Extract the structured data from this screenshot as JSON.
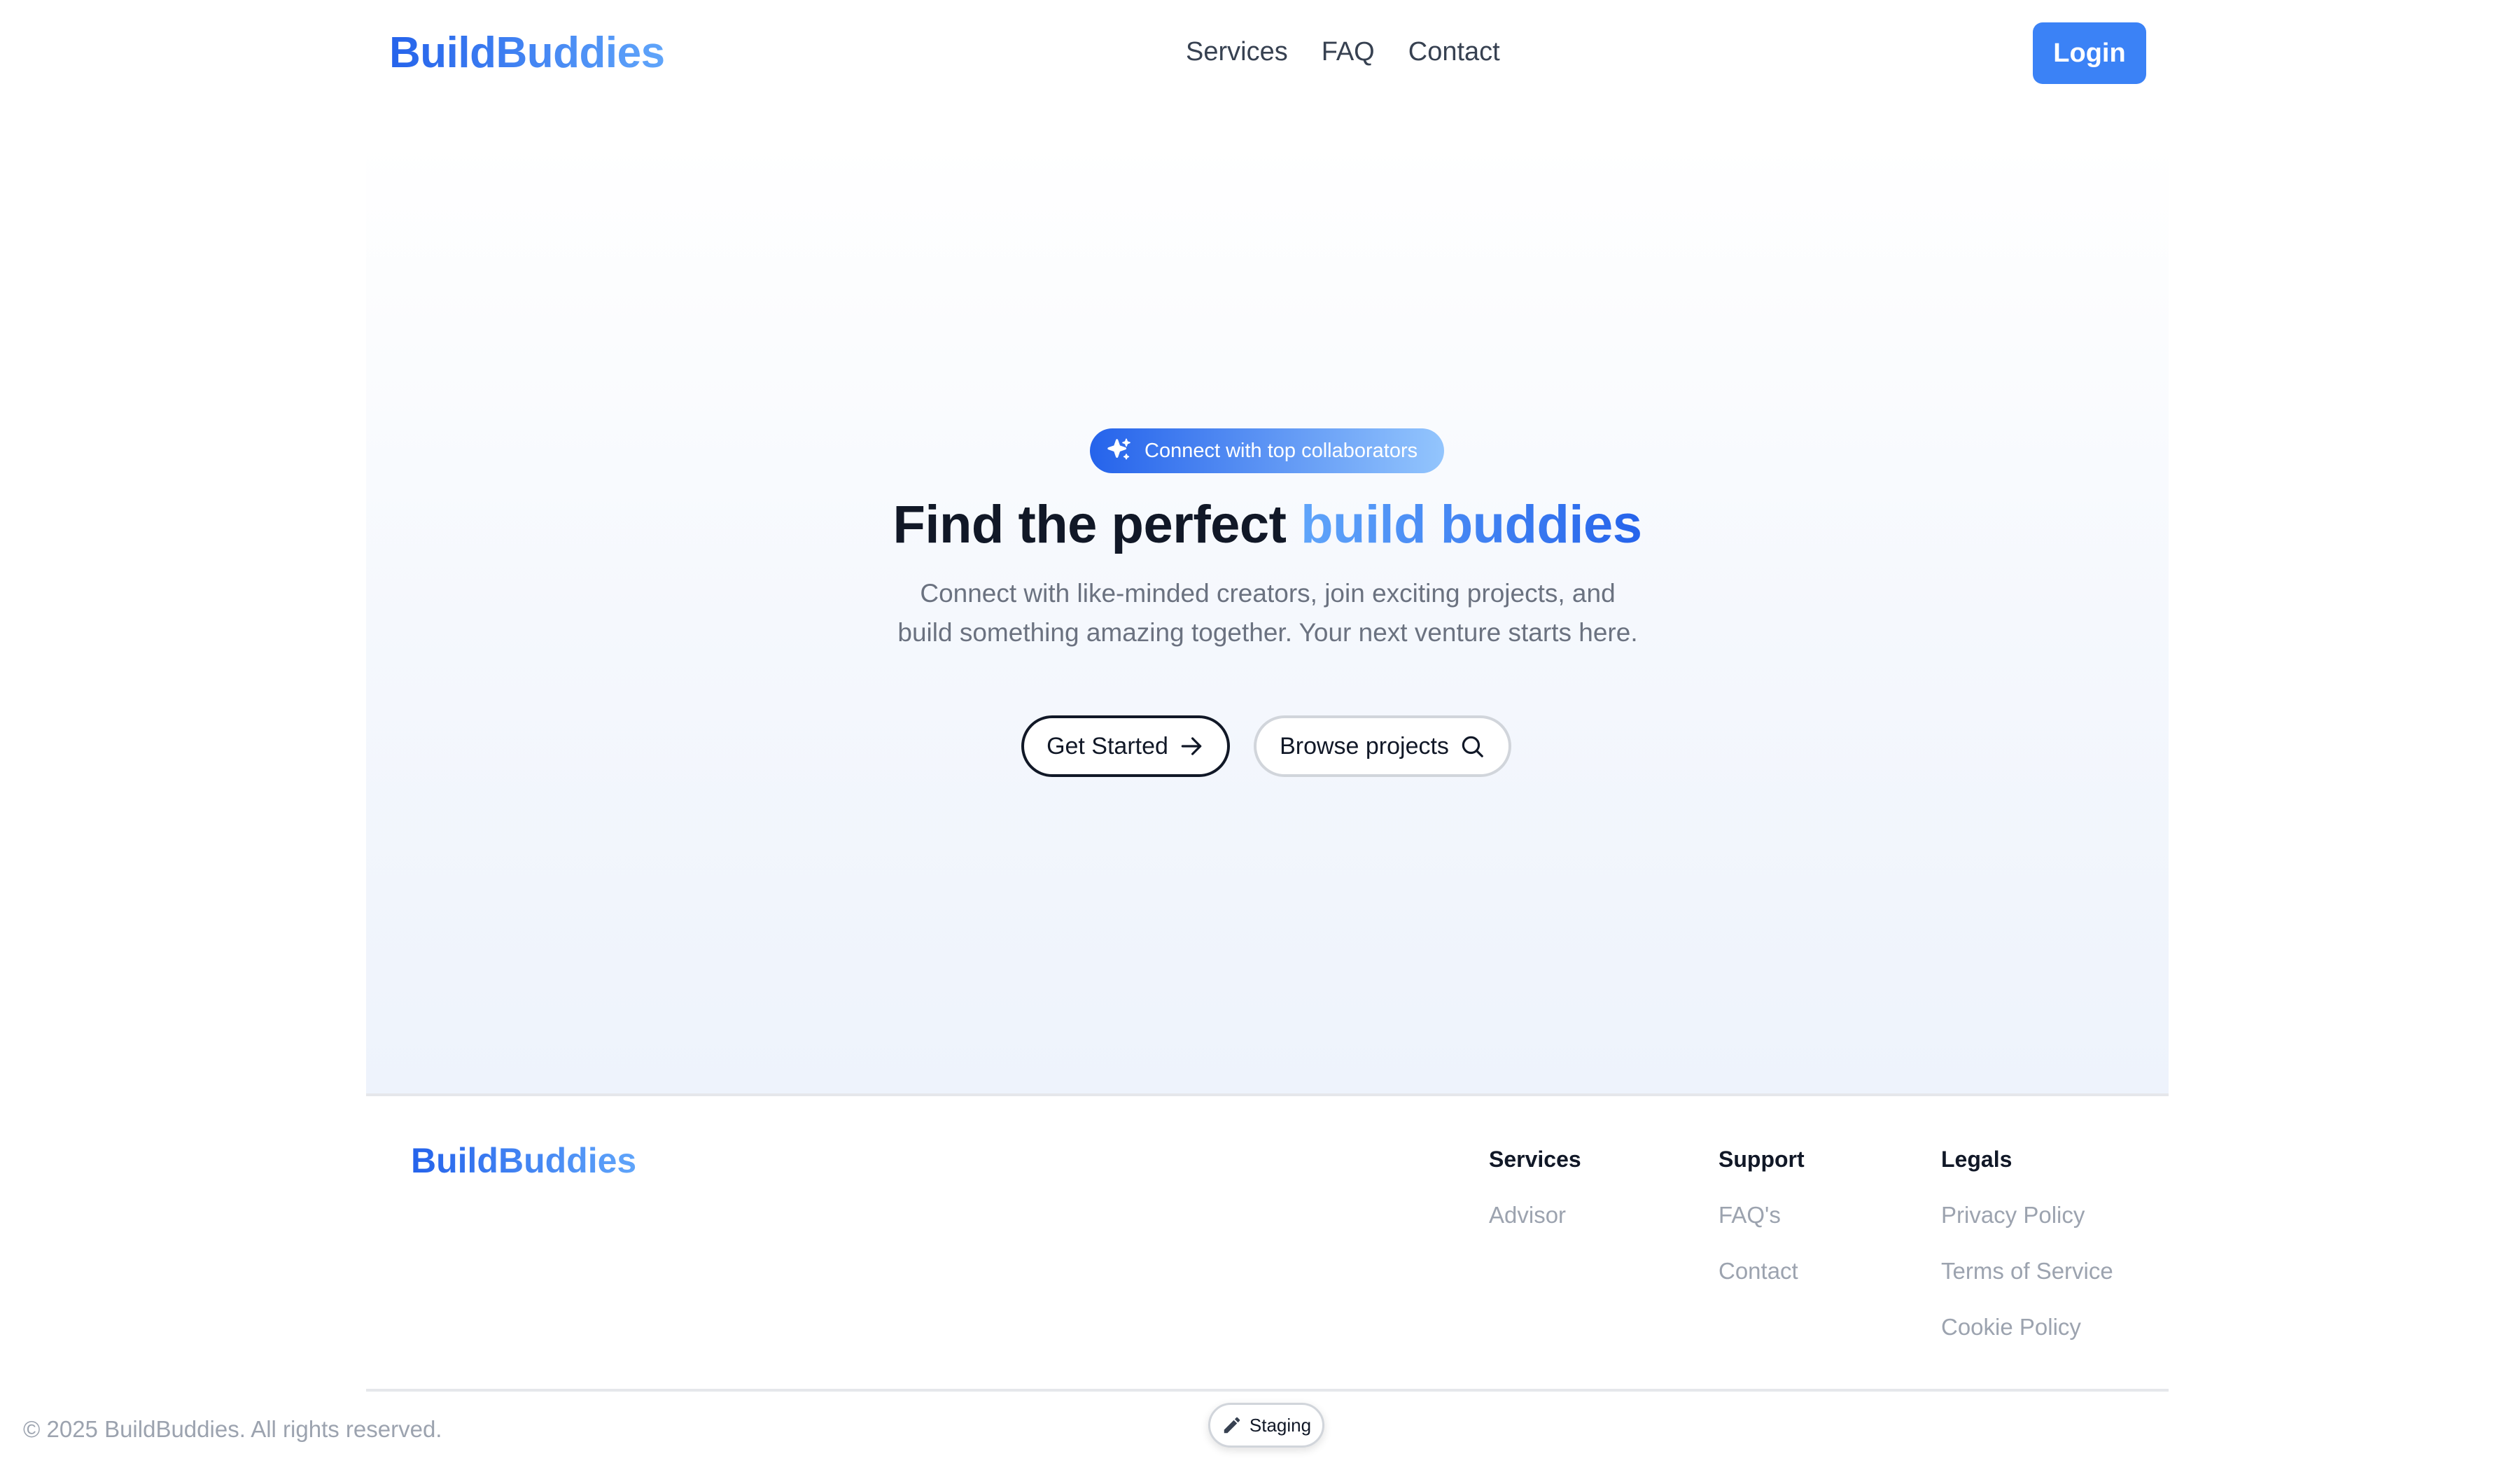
{
  "brand": {
    "name": "BuildBuddies"
  },
  "nav": {
    "links": [
      "Services",
      "FAQ",
      "Contact"
    ],
    "login_label": "Login"
  },
  "hero": {
    "badge": "Connect with top collaborators",
    "title_main": "Find the perfect ",
    "title_accent": "build buddies",
    "subtitle": "Connect with like-minded creators, join exciting projects, and build something amazing together. Your next venture starts here.",
    "primary_button": "Get Started",
    "secondary_button": "Browse projects"
  },
  "footer": {
    "brand": "BuildBuddies",
    "columns": [
      {
        "heading": "Services",
        "links": [
          "Advisor"
        ]
      },
      {
        "heading": "Support",
        "links": [
          "FAQ's",
          "Contact"
        ]
      },
      {
        "heading": "Legals",
        "links": [
          "Privacy Policy",
          "Terms of Service",
          "Cookie Policy"
        ]
      }
    ],
    "copyright": "© 2025 BuildBuddies. All rights reserved."
  },
  "staging": {
    "label": "Staging"
  },
  "icons": {
    "badge": "sparkles-icon",
    "primary": "arrow-right-icon",
    "secondary": "search-icon",
    "staging": "pencil-icon"
  },
  "colors": {
    "brand_blue": "#2563eb",
    "brand_light": "#60a5fa",
    "login_bg": "#3b82f6",
    "text_dark": "#111827",
    "text_muted": "#6b7280",
    "link_muted": "#9ca3af"
  }
}
